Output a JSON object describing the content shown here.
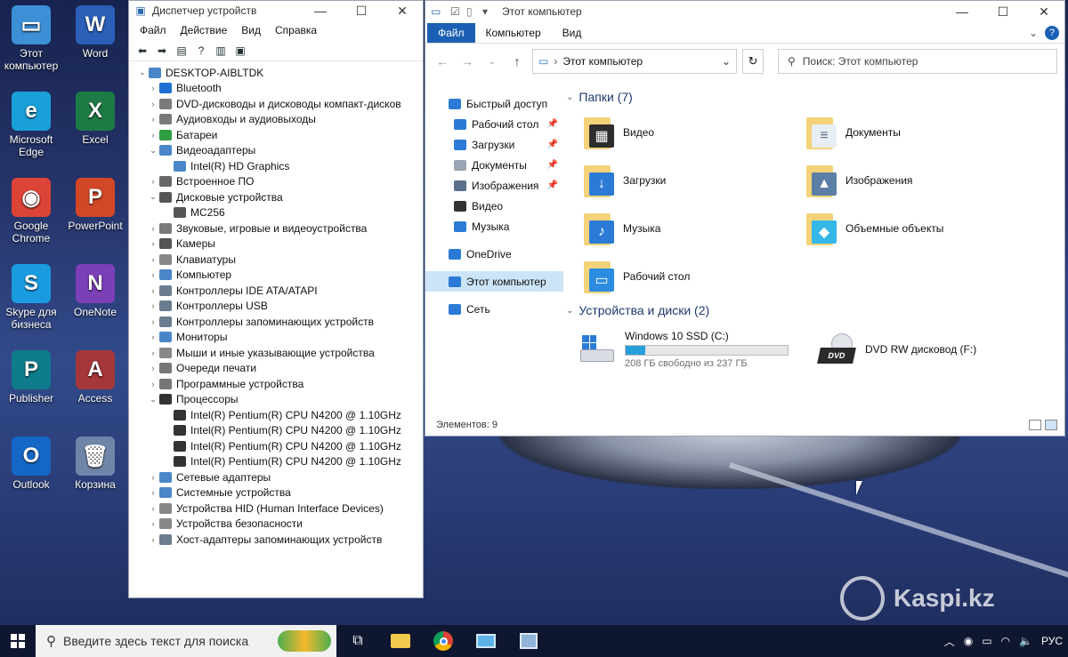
{
  "desktop": {
    "icons": [
      {
        "label": "Этот компьютер",
        "icon": "monitor-icon",
        "color": "#3d8fd6",
        "glyph": "▭"
      },
      {
        "label": "Word",
        "icon": "word-icon",
        "color": "#2b5fb8",
        "glyph": "W"
      },
      {
        "label": "Microsoft Edge",
        "icon": "edge-icon",
        "color": "#1aa0d8",
        "glyph": "e"
      },
      {
        "label": "Excel",
        "icon": "excel-icon",
        "color": "#1e7a45",
        "glyph": "X"
      },
      {
        "label": "Google Chrome",
        "icon": "chrome-icon",
        "color": "#db4437",
        "glyph": "◉"
      },
      {
        "label": "PowerPoint",
        "icon": "powerpoint-icon",
        "color": "#d24726",
        "glyph": "P"
      },
      {
        "label": "Skype для бизнеса",
        "icon": "skype-icon",
        "color": "#1a9be0",
        "glyph": "S"
      },
      {
        "label": "OneNote",
        "icon": "onenote-icon",
        "color": "#7b3fb6",
        "glyph": "N"
      },
      {
        "label": "Publisher",
        "icon": "publisher-icon",
        "color": "#0e7c8c",
        "glyph": "P"
      },
      {
        "label": "Access",
        "icon": "access-icon",
        "color": "#a4373a",
        "glyph": "A"
      },
      {
        "label": "Outlook",
        "icon": "outlook-icon",
        "color": "#1467c4",
        "glyph": "O"
      },
      {
        "label": "Корзина",
        "icon": "recycle-bin-icon",
        "color": "#6f86a8",
        "glyph": "🗑"
      }
    ],
    "watermark": "Kaspi.kz"
  },
  "device_manager": {
    "title": "Диспетчер устройств",
    "menu": [
      "Файл",
      "Действие",
      "Вид",
      "Справка"
    ],
    "root": "DESKTOP-AIBLTDK",
    "nodes": [
      {
        "label": "Bluetooth",
        "expanded": false,
        "icon_color": "#1f6fd0",
        "children": []
      },
      {
        "label": "DVD-дисководы и дисководы компакт-дисков",
        "expanded": false,
        "icon_color": "#7a7a7a",
        "children": []
      },
      {
        "label": "Аудиовходы и аудиовыходы",
        "expanded": false,
        "icon_color": "#7a7a7a",
        "children": []
      },
      {
        "label": "Батареи",
        "expanded": false,
        "icon_color": "#2f9e44",
        "children": []
      },
      {
        "label": "Видеоадаптеры",
        "expanded": true,
        "icon_color": "#4a86c8",
        "children": [
          "Intel(R) HD Graphics"
        ]
      },
      {
        "label": "Встроенное ПО",
        "expanded": false,
        "icon_color": "#666666",
        "children": []
      },
      {
        "label": "Дисковые устройства",
        "expanded": true,
        "icon_color": "#555555",
        "children": [
          "MC256"
        ]
      },
      {
        "label": "Звуковые, игровые и видеоустройства",
        "expanded": false,
        "icon_color": "#7a7a7a",
        "children": []
      },
      {
        "label": "Камеры",
        "expanded": false,
        "icon_color": "#555555",
        "children": []
      },
      {
        "label": "Клавиатуры",
        "expanded": false,
        "icon_color": "#888888",
        "children": []
      },
      {
        "label": "Компьютер",
        "expanded": false,
        "icon_color": "#4a86c8",
        "children": []
      },
      {
        "label": "Контроллеры IDE ATA/ATAPI",
        "expanded": false,
        "icon_color": "#6b7c8f",
        "children": []
      },
      {
        "label": "Контроллеры USB",
        "expanded": false,
        "icon_color": "#6b7c8f",
        "children": []
      },
      {
        "label": "Контроллеры запоминающих устройств",
        "expanded": false,
        "icon_color": "#6b7c8f",
        "children": []
      },
      {
        "label": "Мониторы",
        "expanded": false,
        "icon_color": "#4a86c8",
        "children": []
      },
      {
        "label": "Мыши и иные указывающие устройства",
        "expanded": false,
        "icon_color": "#888888",
        "children": []
      },
      {
        "label": "Очереди печати",
        "expanded": false,
        "icon_color": "#777777",
        "children": []
      },
      {
        "label": "Программные устройства",
        "expanded": false,
        "icon_color": "#777777",
        "children": []
      },
      {
        "label": "Процессоры",
        "expanded": true,
        "icon_color": "#333333",
        "children": [
          "Intel(R) Pentium(R) CPU N4200 @ 1.10GHz",
          "Intel(R) Pentium(R) CPU N4200 @ 1.10GHz",
          "Intel(R) Pentium(R) CPU N4200 @ 1.10GHz",
          "Intel(R) Pentium(R) CPU N4200 @ 1.10GHz"
        ]
      },
      {
        "label": "Сетевые адаптеры",
        "expanded": false,
        "icon_color": "#4a86c8",
        "children": []
      },
      {
        "label": "Системные устройства",
        "expanded": false,
        "icon_color": "#4a86c8",
        "children": []
      },
      {
        "label": "Устройства HID (Human Interface Devices)",
        "expanded": false,
        "icon_color": "#888888",
        "children": []
      },
      {
        "label": "Устройства безопасности",
        "expanded": false,
        "icon_color": "#888888",
        "children": []
      },
      {
        "label": "Хост-адаптеры запоминающих устройств",
        "expanded": false,
        "icon_color": "#6b7c8f",
        "children": []
      }
    ]
  },
  "explorer": {
    "title": "Этот компьютер",
    "ribbon_tabs": [
      "Файл",
      "Компьютер",
      "Вид"
    ],
    "address": "Этот компьютер",
    "search_placeholder": "Поиск: Этот компьютер",
    "nav": [
      {
        "label": "Быстрый доступ",
        "icon": "star-icon",
        "color": "#2b7bd6",
        "sub": false,
        "pinned": false
      },
      {
        "label": "Рабочий стол",
        "icon": "desktop-icon",
        "color": "#2b7bd6",
        "sub": true,
        "pinned": true
      },
      {
        "label": "Загрузки",
        "icon": "download-icon",
        "color": "#2b7bd6",
        "sub": true,
        "pinned": true
      },
      {
        "label": "Документы",
        "icon": "document-icon",
        "color": "#9aa4b2",
        "sub": true,
        "pinned": true
      },
      {
        "label": "Изображения",
        "icon": "pictures-icon",
        "color": "#5a6f8c",
        "sub": true,
        "pinned": true
      },
      {
        "label": "Видео",
        "icon": "video-icon",
        "color": "#333333",
        "sub": true,
        "pinned": false
      },
      {
        "label": "Музыка",
        "icon": "music-icon",
        "color": "#2b7bd6",
        "sub": true,
        "pinned": false
      },
      {
        "label": "OneDrive",
        "icon": "cloud-icon",
        "color": "#2b7bd6",
        "sub": false,
        "pinned": false
      },
      {
        "label": "Этот компьютер",
        "icon": "computer-icon",
        "color": "#2b7bd6",
        "sub": false,
        "pinned": false,
        "selected": true
      },
      {
        "label": "Сеть",
        "icon": "network-icon",
        "color": "#2b7bd6",
        "sub": false,
        "pinned": false
      }
    ],
    "folders_header": "Папки (7)",
    "folders": [
      {
        "label": "Видео",
        "icon": "video-folder-icon",
        "color": "#2e2e2e",
        "glyph": "▦"
      },
      {
        "label": "Документы",
        "icon": "documents-folder-icon",
        "color": "#e9eef4",
        "glyph": "≡"
      },
      {
        "label": "Загрузки",
        "icon": "downloads-folder-icon",
        "color": "#2b7bd6",
        "glyph": "↓"
      },
      {
        "label": "Изображения",
        "icon": "pictures-folder-icon",
        "color": "#5c7fa6",
        "glyph": "▲"
      },
      {
        "label": "Музыка",
        "icon": "music-folder-icon",
        "color": "#2b7bd6",
        "glyph": "♪"
      },
      {
        "label": "Объемные объекты",
        "icon": "3d-objects-folder-icon",
        "color": "#35b7e8",
        "glyph": "◆"
      },
      {
        "label": "Рабочий стол",
        "icon": "desktop-folder-icon",
        "color": "#2b8ce0",
        "glyph": "▭"
      }
    ],
    "drives_header": "Устройства и диски (2)",
    "drives": [
      {
        "label": "Windows 10 SSD (C:)",
        "free_text": "208 ГБ свободно из 237 ГБ",
        "used_fraction": 0.12,
        "icon": "ssd-drive-icon"
      },
      {
        "label": "DVD RW дисковод (F:)",
        "icon": "dvd-drive-icon",
        "badge": "DVD"
      }
    ],
    "status": "Элементов: 9"
  },
  "taskbar": {
    "search_placeholder": "Введите здесь текст для поиска",
    "lang": "РУС"
  }
}
